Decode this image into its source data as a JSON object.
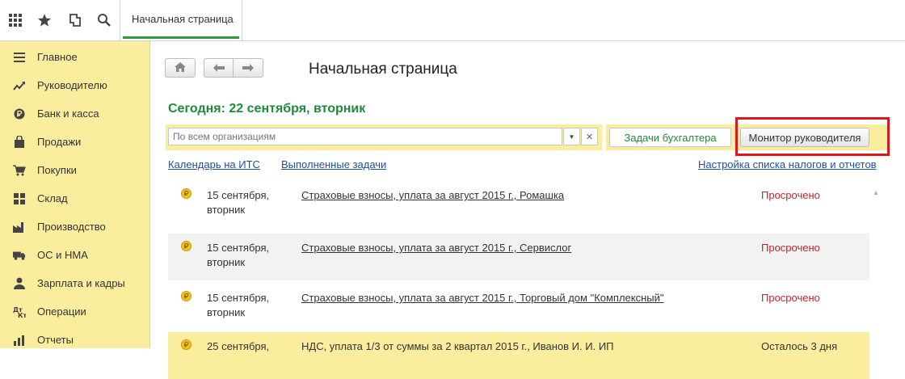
{
  "topbar": {
    "icons": [
      "apps-grid-icon",
      "favorites-star-icon",
      "history-icon",
      "search-icon"
    ],
    "tab_label": "Начальная страница"
  },
  "sidebar": {
    "items": [
      {
        "label": "Главное",
        "icon": "menu-lines-icon"
      },
      {
        "label": "Руководителю",
        "icon": "trend-chart-icon"
      },
      {
        "label": "Банк и касса",
        "icon": "ruble-coin-icon"
      },
      {
        "label": "Продажи",
        "icon": "shopping-bag-icon"
      },
      {
        "label": "Покупки",
        "icon": "cart-icon"
      },
      {
        "label": "Склад",
        "icon": "warehouse-grid-icon"
      },
      {
        "label": "Производство",
        "icon": "factory-icon"
      },
      {
        "label": "ОС и НМА",
        "icon": "truck-icon"
      },
      {
        "label": "Зарплата и кадры",
        "icon": "person-icon"
      },
      {
        "label": "Операции",
        "icon": "debit-credit-icon"
      },
      {
        "label": "Отчеты",
        "icon": "bar-chart-icon"
      }
    ]
  },
  "main": {
    "page_title": "Начальная страница",
    "today": "Сегодня: 22 сентября, вторник",
    "org_placeholder": "По всем организациям",
    "tasks_button": "Задачи бухгалтера",
    "monitor_button": "Монитор руководителя",
    "links": {
      "calendar": "Календарь на ИТС",
      "completed": "Выполненные задачи",
      "settings": "Настройка списка налогов и отчетов"
    },
    "rows": [
      {
        "date_line1": "15 сентября,",
        "date_line2": "вторник",
        "title": "Страховые взносы, уплата за август 2015 г., Ромашка",
        "status": "Просрочено"
      },
      {
        "date_line1": "15 сентября,",
        "date_line2": "вторник",
        "title": "Страховые взносы, уплата за август 2015 г., Сервислог",
        "status": "Просрочено"
      },
      {
        "date_line1": "15 сентября,",
        "date_line2": "вторник",
        "title": "Страховые взносы, уплата за август 2015 г., Торговый дом \"Комплексный\"",
        "status": "Просрочено"
      },
      {
        "date_line1": "25 сентября,",
        "date_line2": "",
        "title": "НДС, уплата 1/3 от суммы за 2 квартал 2015 г., Иванов И. И. ИП",
        "status": "Осталось 3 дня"
      }
    ]
  },
  "colors": {
    "sidebar_bg": "#fbed9e",
    "accent_green": "#1d8a3c",
    "overdue_red": "#c0252a",
    "link_blue": "#1f4e9c",
    "highlight_box": "#d8191f"
  }
}
